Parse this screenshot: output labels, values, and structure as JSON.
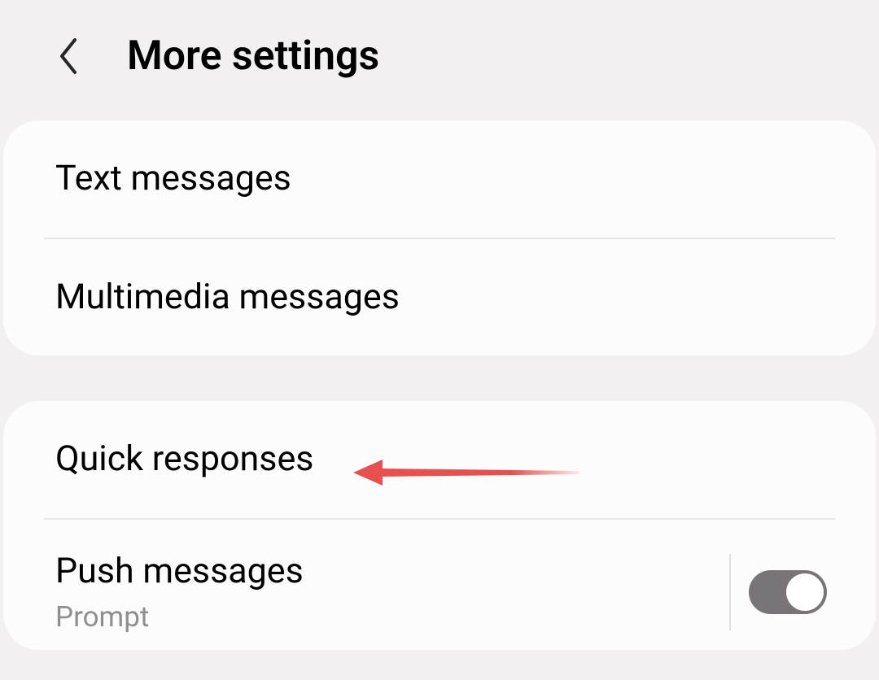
{
  "header": {
    "title": "More settings"
  },
  "group1": {
    "items": [
      {
        "label": "Text messages"
      },
      {
        "label": "Multimedia messages"
      }
    ]
  },
  "group2": {
    "quick_responses": {
      "label": "Quick responses"
    },
    "push_messages": {
      "label": "Push messages",
      "subtext": "Prompt",
      "enabled": true
    }
  }
}
